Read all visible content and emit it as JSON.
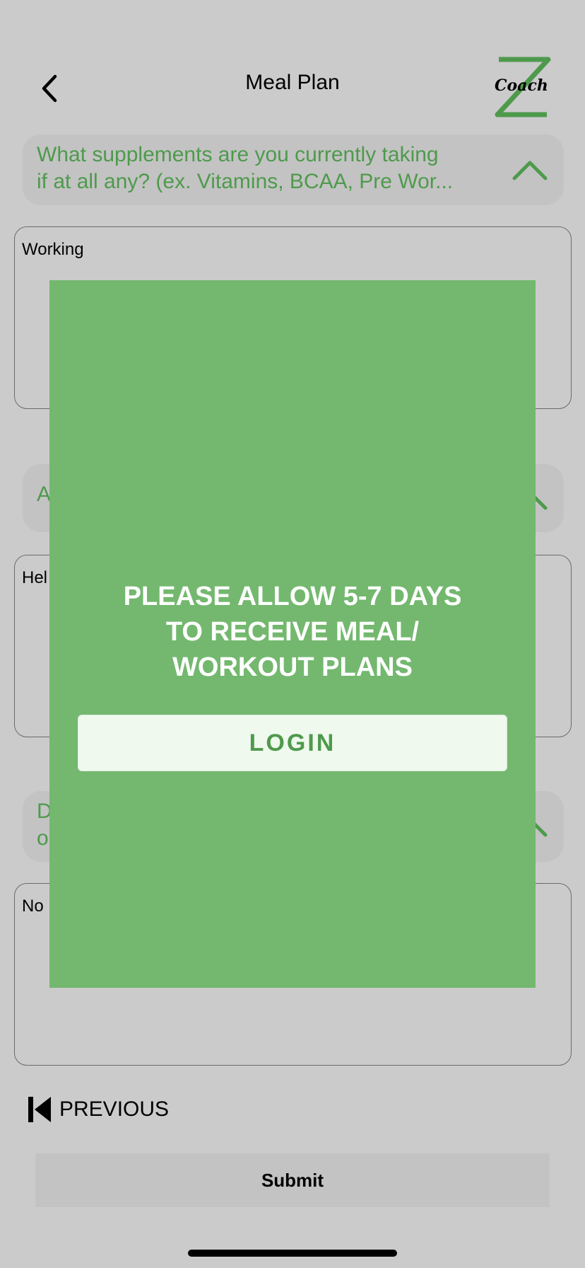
{
  "header": {
    "title": "Meal Plan",
    "logo_text": "Coach",
    "logo_sub": "Z"
  },
  "questions": [
    {
      "text": "What supplements are you currently taking\nif at all any? (ex. Vitamins, BCAA, Pre Wor...",
      "answer": "Working"
    },
    {
      "text": "A",
      "answer": "Hel"
    },
    {
      "text": "D\no",
      "answer": "No"
    }
  ],
  "nav": {
    "previous_label": "PREVIOUS",
    "submit_label": "Submit"
  },
  "modal": {
    "message": "PLEASE ALLOW 5-7 DAYS\nTO RECEIVE MEAL/\nWORKOUT PLANS",
    "login_label": "LOGIN"
  },
  "colors": {
    "background": "#cbcbcb",
    "accent_green": "#4e9a4c",
    "modal_green": "#73b86e"
  }
}
